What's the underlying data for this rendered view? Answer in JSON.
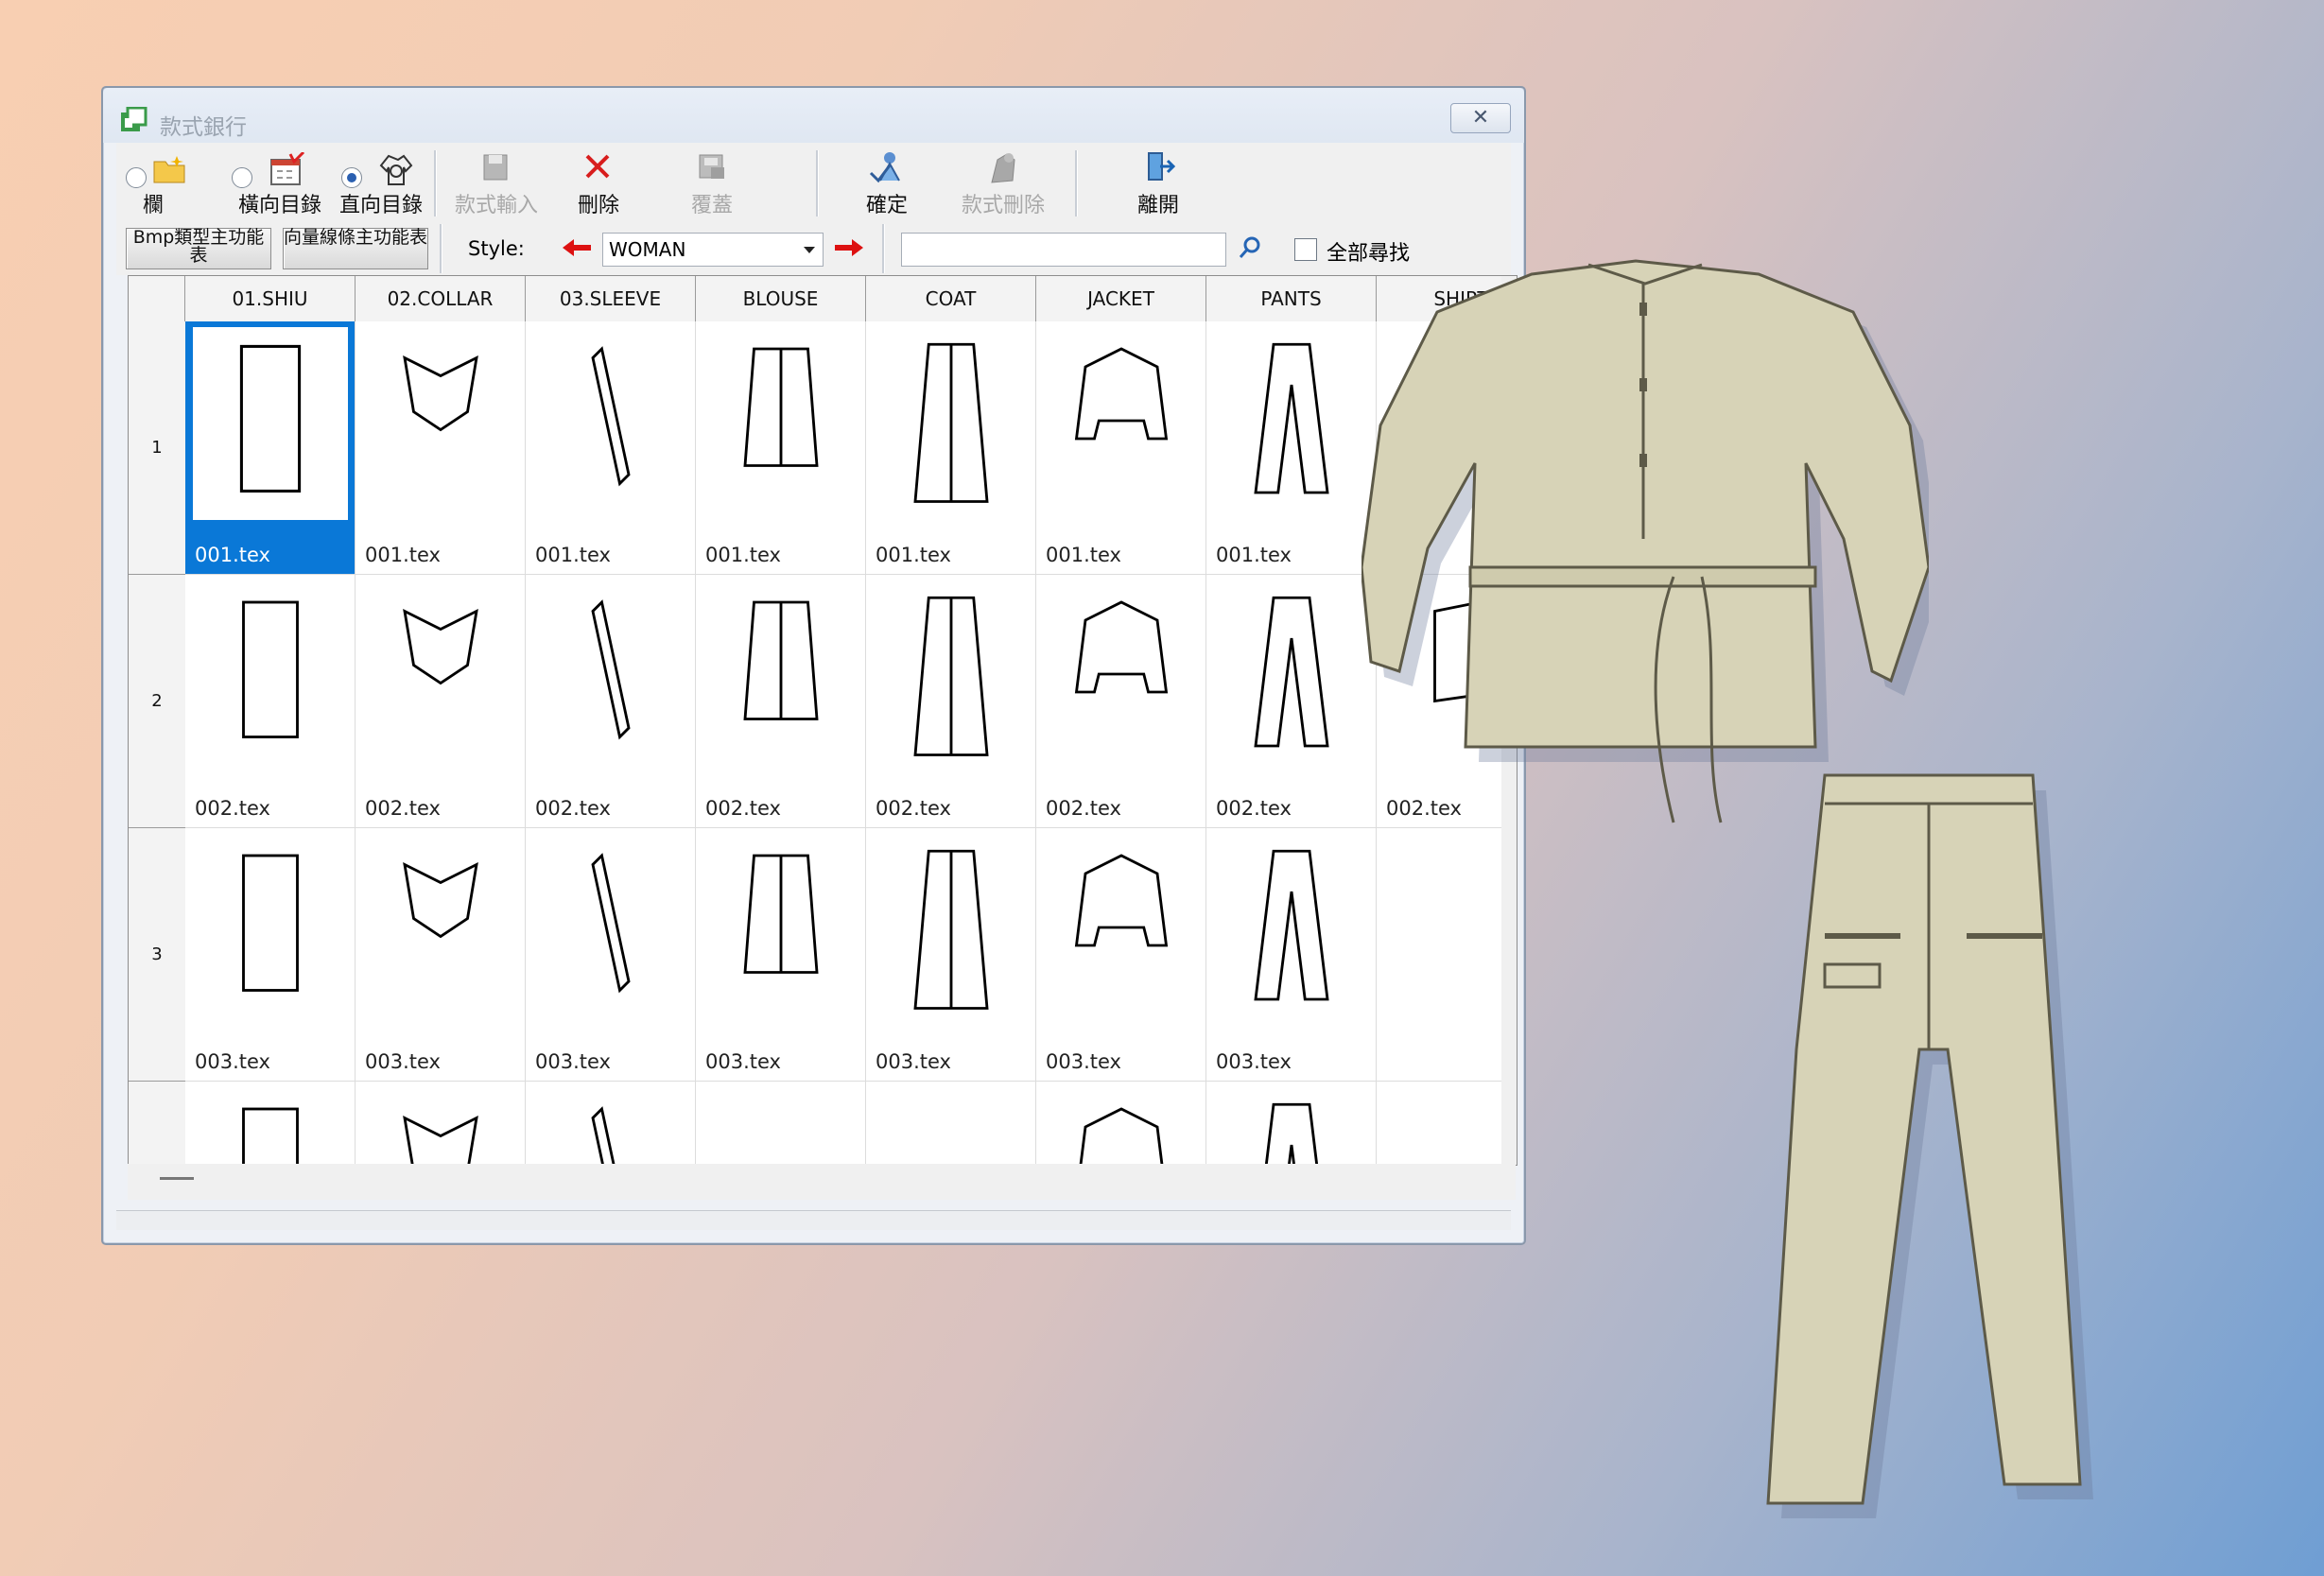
{
  "window": {
    "title": "款式銀行"
  },
  "toolbar": {
    "view_options": [
      {
        "label": "欄",
        "selected": false,
        "icon": "folder-icon"
      },
      {
        "label": "橫向目錄",
        "selected": false,
        "icon": "calendar-check-icon"
      },
      {
        "label": "直向目錄",
        "selected": true,
        "icon": "shirt-outline-icon"
      }
    ],
    "buttons": [
      {
        "label": "款式輸入",
        "enabled": false,
        "icon": "save-disk-icon"
      },
      {
        "label": "刪除",
        "enabled": true,
        "icon": "red-x-icon"
      },
      {
        "label": "覆蓋",
        "enabled": false,
        "icon": "overwrite-disk-icon"
      },
      {
        "label": "確定",
        "enabled": true,
        "icon": "confirm-figure-icon"
      },
      {
        "label": "款式刪除",
        "enabled": false,
        "icon": "style-delete-icon"
      },
      {
        "label": "離開",
        "enabled": true,
        "icon": "exit-door-icon"
      }
    ]
  },
  "filterbar": {
    "bmp_button": "Bmp類型主功能表",
    "vector_button": "向量線條主功能表",
    "style_label": "Style:",
    "style_value": "WOMAN",
    "search_value": "",
    "search_all_label": "全部尋找"
  },
  "grid": {
    "columns": [
      "01.SHIU",
      "02.COLLAR",
      "03.SLEEVE",
      "BLOUSE",
      "COAT",
      "JACKET",
      "PANTS",
      "SHIRT"
    ],
    "rows": [
      {
        "number": "1",
        "cells": [
          "001.tex",
          "001.tex",
          "001.tex",
          "001.tex",
          "001.tex",
          "001.tex",
          "001.tex",
          ""
        ]
      },
      {
        "number": "2",
        "cells": [
          "002.tex",
          "002.tex",
          "002.tex",
          "002.tex",
          "002.tex",
          "002.tex",
          "002.tex",
          "002.tex"
        ]
      },
      {
        "number": "3",
        "cells": [
          "003.tex",
          "003.tex",
          "003.tex",
          "003.tex",
          "003.tex",
          "003.tex",
          "003.tex",
          ""
        ]
      },
      {
        "number": "",
        "cells": [
          "",
          "",
          "",
          "",
          "",
          "",
          "",
          ""
        ]
      }
    ],
    "selected_cell": "row1-col1"
  },
  "colors": {
    "selection": "#0a78d7",
    "garment_fill": "#d6d2b6",
    "window_bg": "#eef1f6"
  }
}
